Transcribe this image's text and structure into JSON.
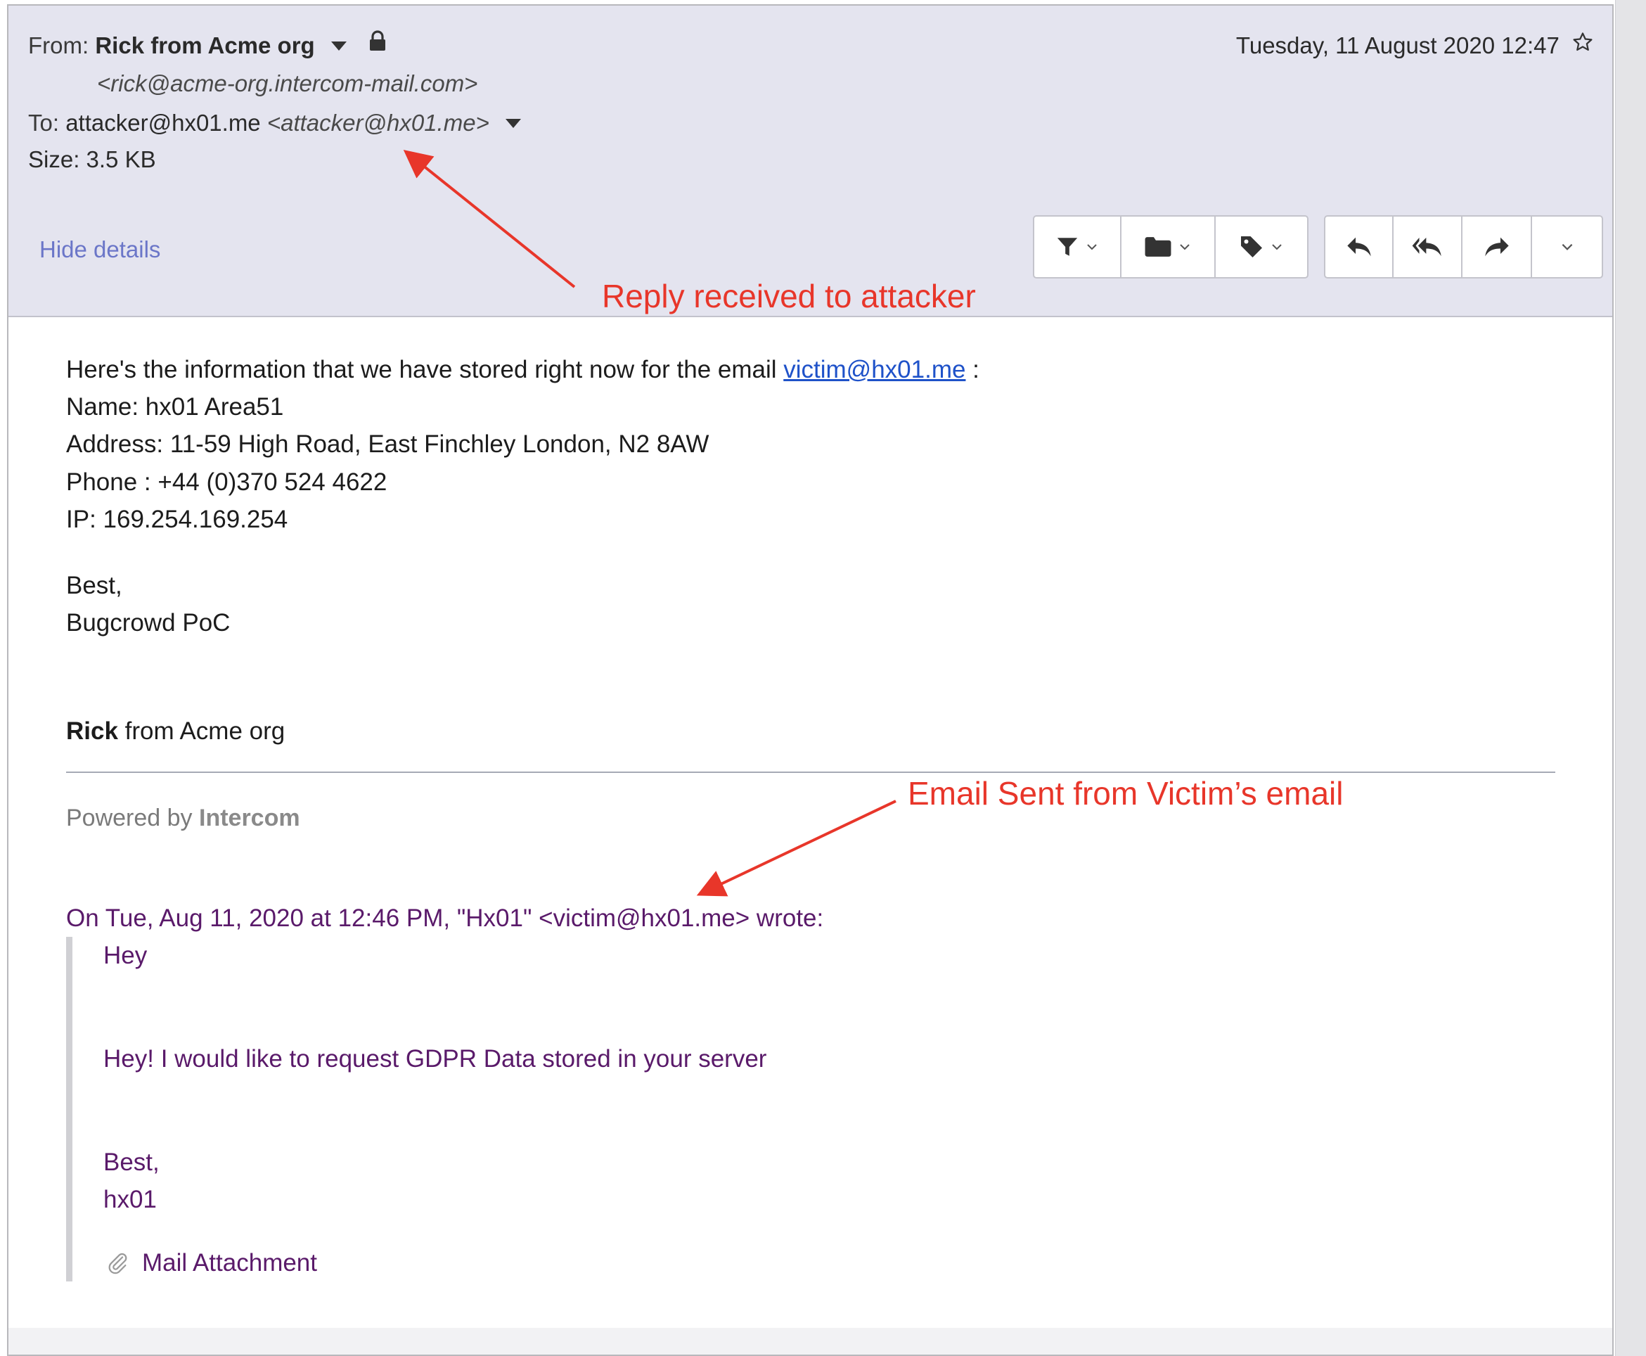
{
  "header": {
    "from_label": "From:",
    "from_name": "Rick from Acme org",
    "from_email": "<rick@acme-org.intercom-mail.com>",
    "to_label": "To:",
    "to_name": "attacker@hx01.me",
    "to_email": "<attacker@hx01.me>",
    "size": "Size: 3.5 KB",
    "date": "Tuesday, 11 August 2020 12:47",
    "hide_details": "Hide details"
  },
  "toolbar": {
    "filter": "filter-icon",
    "folder": "folder-icon",
    "tag": "tag-icon",
    "reply": "reply-icon",
    "reply_all": "reply-all-icon",
    "forward": "forward-icon",
    "more": "chevron-down-icon"
  },
  "annotations": {
    "reply_received": "Reply received to attacker",
    "email_sent": "Email Sent from Victim’s email",
    "color": "#e8362a"
  },
  "body": {
    "intro_prefix": "Here's the information that we have stored right now for the email ",
    "intro_link": "victim@hx01.me",
    "intro_suffix": " :",
    "name": "Name: hx01 Area51",
    "address": "Address: 11-59 High Road, East Finchley London, N2 8AW",
    "phone": "Phone : +44 (0)370 524 4622",
    "ip": "IP: 169.254.169.254",
    "closing": "Best,",
    "signoff": "Bugcrowd PoC",
    "sender_first": "Rick",
    "sender_rest": " from Acme org",
    "powered_prefix": "Powered by ",
    "powered_brand": "Intercom"
  },
  "quote": {
    "header": "On Tue, Aug 11, 2020 at 12:46 PM, \"Hx01\" <victim@hx01.me> wrote:",
    "line1": "Hey",
    "line2": "Hey! I would like to request GDPR Data stored in your server",
    "closing": "Best,",
    "signoff": "hx01",
    "attachment": "Mail Attachment",
    "color": "#5a1a6a"
  }
}
